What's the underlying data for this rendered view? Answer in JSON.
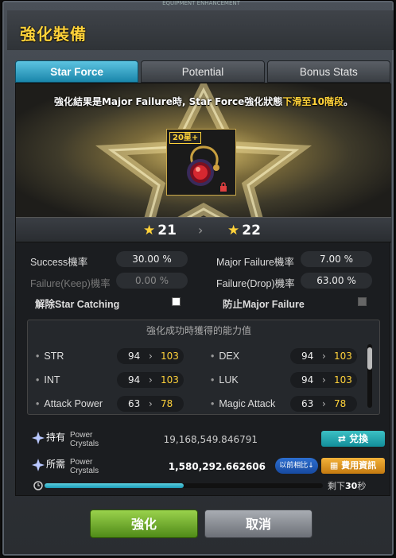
{
  "window": {
    "top_caption": "EQUIPMENT ENHANCEMENT",
    "title": "強化裝備"
  },
  "tabs": [
    {
      "label": "Star Force",
      "active": true
    },
    {
      "label": "Potential",
      "active": false
    },
    {
      "label": "Bonus Stats",
      "active": false
    }
  ],
  "notice": {
    "prefix": "強化結果是Major Failure時, Star Force強化狀態",
    "highlight": "下滑至10階段",
    "suffix": "。"
  },
  "item": {
    "star_badge": "20星+",
    "icon": "pendant-ring-icon"
  },
  "star_level": {
    "current": "21",
    "next": "22"
  },
  "rates": {
    "success_label": "Success機率",
    "success_value": "30.00 %",
    "major_failure_label": "Major Failure機率",
    "major_failure_value": "7.00 %",
    "failure_keep_label": "Failure(Keep)機率",
    "failure_keep_value": "0.00 %",
    "failure_drop_label": "Failure(Drop)機率",
    "failure_drop_value": "63.00 %",
    "star_catching_label": "解除Star Catching",
    "star_catching_checked": true,
    "prevent_major_label": "防止Major Failure",
    "prevent_major_checked": false
  },
  "gain": {
    "title": "強化成功時獲得的能力值",
    "stats": [
      {
        "name": "STR",
        "from": "94",
        "to": "103"
      },
      {
        "name": "DEX",
        "from": "94",
        "to": "103"
      },
      {
        "name": "INT",
        "from": "94",
        "to": "103"
      },
      {
        "name": "LUK",
        "from": "94",
        "to": "103"
      },
      {
        "name": "Attack Power",
        "from": "63",
        "to": "78"
      },
      {
        "name": "Magic Attack",
        "from": "63",
        "to": "78"
      }
    ]
  },
  "cost": {
    "owned_zh": "持有",
    "owned_en": "Power Crystals",
    "owned_value": "19,168,549.846791",
    "exchange_label": "兌換",
    "required_zh": "所需",
    "required_en": "Power Crystals",
    "required_value": "1,580,292.662606",
    "compare_label": "以前相比",
    "fee_info_label": "費用資訊",
    "timer_prefix": "剩下",
    "timer_value": "30",
    "timer_suffix": "秒",
    "timer_progress": 0.5
  },
  "buttons": {
    "enhance": "強化",
    "cancel": "取消"
  },
  "colors": {
    "accent_gold": "#ffd23a",
    "tab_active": "#1a86ab",
    "enhance_green": "#6aaa2a"
  }
}
